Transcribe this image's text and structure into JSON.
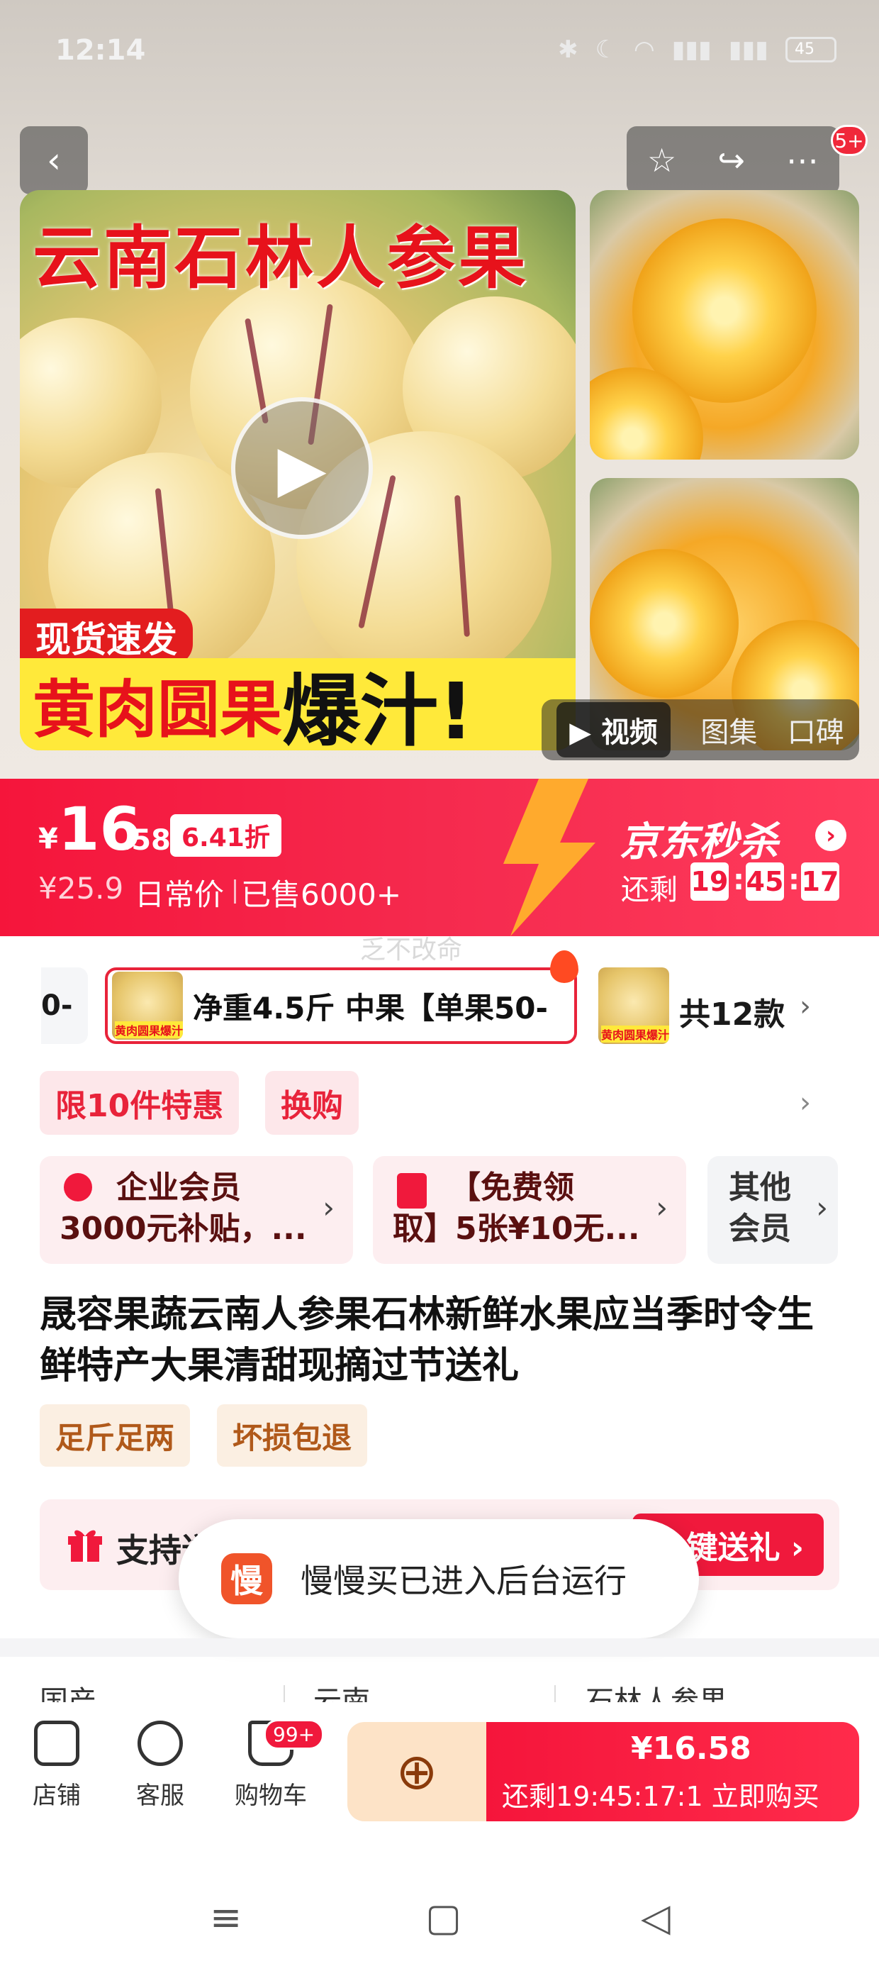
{
  "status_bar": {
    "time": "12:14",
    "battery": "45"
  },
  "gallery": {
    "main_title": "云南石林人参果",
    "tag_stock": "现货速发",
    "tag_red": "黄肉圆果",
    "tag_black": "爆汁!",
    "badge": "5+",
    "media_tabs": [
      "视频",
      "图集",
      "口碑"
    ]
  },
  "price": {
    "currency": "¥",
    "main": "16",
    "decimal": ".58",
    "discount": "6.41折",
    "original": "¥25.9",
    "daily": "日常价",
    "sold": "已售6000+",
    "seckill": "京东秒杀",
    "remain_label": "还剩",
    "h": "19",
    "m": "45",
    "s": "17"
  },
  "watermark": "乏不改命",
  "sku": {
    "prev_fragment": "0-",
    "selected_label": "净重4.5斤 中果【单果50-",
    "thumb_text": "黄肉圆果爆汁",
    "count": "共12款"
  },
  "promo_tags": [
    "限10件特惠",
    "换购"
  ],
  "promo_cards": {
    "enterprise": "企业会员\n3000元补贴，...",
    "coupon": "【免费领\n取】5张¥10无...",
    "other": "其他\n会员"
  },
  "title": "晟容果蔬云南人参果石林新鲜水果应当季时令生鲜特产大果清甜现摘过节送礼",
  "guarantees": [
    "足斤足两",
    "坏损包退"
  ],
  "gift": {
    "text": "支持送",
    "button": "键送礼 ›"
  },
  "toast": {
    "icon": "慢",
    "text": "慢慢买已进入后台运行"
  },
  "specs": [
    "国产",
    "云南",
    "石林人参果"
  ],
  "bottom": {
    "shop": "店铺",
    "service": "客服",
    "cart": "购物车",
    "cart_badge": "99+",
    "buy_price": "¥16.58",
    "buy_sub": "还剩19:45:17:1  立即购买"
  }
}
